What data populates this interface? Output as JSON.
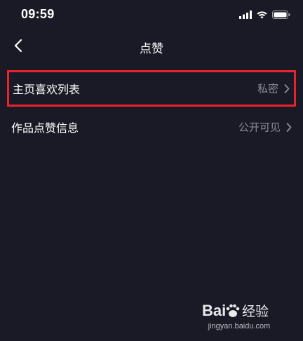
{
  "status_bar": {
    "time": "09:59",
    "icons": [
      "cellular-signal-icon",
      "wifi-icon",
      "battery-icon"
    ]
  },
  "nav": {
    "back_icon": "chevron-left-icon",
    "title": "点赞"
  },
  "settings": [
    {
      "label": "主页喜欢列表",
      "value": "私密",
      "highlighted": true
    },
    {
      "label": "作品点赞信息",
      "value": "公开可见",
      "highlighted": false
    }
  ],
  "watermark": {
    "logo_text": "Bai 经验",
    "url": "jingyan.baidu.com"
  },
  "colors": {
    "background": "#1a1a26",
    "text_primary": "#ffffff",
    "text_secondary": "#8a8b93",
    "highlight_border": "#e8232f"
  }
}
